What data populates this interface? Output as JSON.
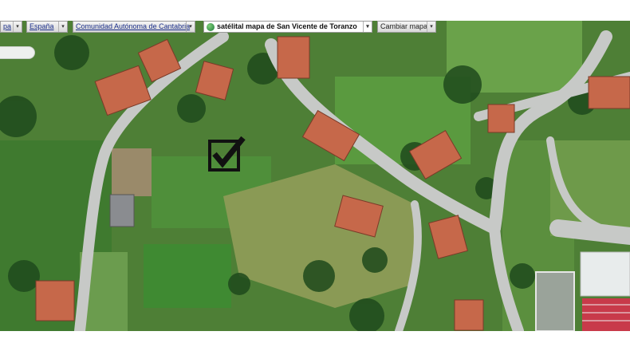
{
  "toolbar": {
    "items": [
      {
        "label": "pa",
        "dropdown": true
      },
      {
        "label": "España",
        "dropdown": true
      },
      {
        "label": "Comunidad Autónoma de Cantabria",
        "dropdown": true
      },
      {
        "label": "satélital mapa de San Vicente de Toranzo",
        "dropdown": true
      },
      {
        "label": "Cambiar mapa",
        "dropdown": true
      }
    ]
  },
  "icons": {
    "globe": "globe-icon",
    "checkbox": "checkmark-box-icon",
    "caret": "▾"
  },
  "colors": {
    "link": "#1b2f8a",
    "grass": "#4f8f3a",
    "roof": "#c8694a",
    "road": "#c9c9c9"
  }
}
